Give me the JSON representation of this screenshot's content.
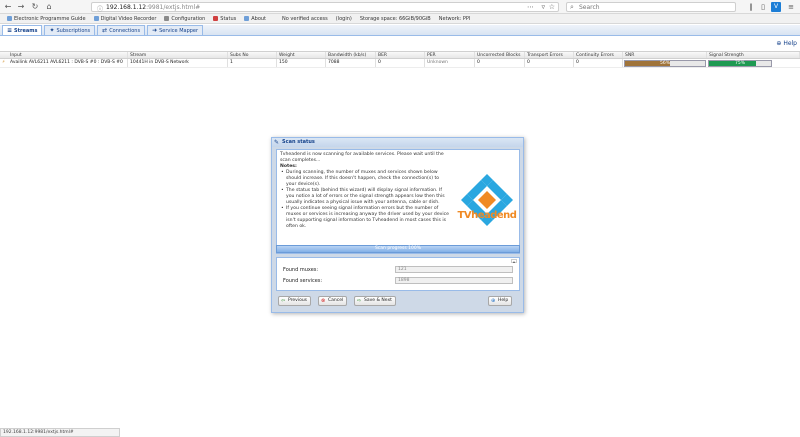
{
  "browser": {
    "url_host": "192.168.1.12",
    "url_rest": ":9981/extjs.html#",
    "search_placeholder": "Search",
    "nav": {
      "back": "←",
      "forward": "→",
      "reload": "↻",
      "home": "⌂"
    },
    "toolbar_icons": [
      "library-icon",
      "sidebar-icon",
      "extension-icon",
      "menu-icon"
    ]
  },
  "bookmarks": [
    {
      "label": "Electronic Programme Guide",
      "color": "#6f9fd8"
    },
    {
      "label": "Digital Video Recorder",
      "color": "#6f9fd8"
    },
    {
      "label": "Configuration",
      "color": "#8a8a8a"
    },
    {
      "label": "Status",
      "color": "#d04040"
    },
    {
      "label": "About",
      "color": "#6f9fd8"
    },
    {
      "label": "No verified access",
      "color": ""
    },
    {
      "label": "(login)",
      "color": ""
    },
    {
      "label": "Storage space: 66GiB/90GiB",
      "color": ""
    },
    {
      "label": "Network: PPI",
      "color": ""
    }
  ],
  "subtabs": [
    {
      "label": "Streams",
      "icon": "≡",
      "active": true
    },
    {
      "label": "Subscriptions",
      "icon": "✦",
      "active": false
    },
    {
      "label": "Connections",
      "icon": "⇄",
      "active": false
    },
    {
      "label": "Service Mapper",
      "icon": "➜",
      "active": false
    }
  ],
  "help": "Help",
  "grid": {
    "headers": [
      "Input",
      "Stream",
      "Subs No",
      "Weight",
      "Bandwidth (kb/s)",
      "BER",
      "PER",
      "Uncorrected Blocks",
      "Transport Errors",
      "Continuity Errors",
      "SNR",
      "Signal Strength"
    ],
    "row": {
      "input": "Availink AVL6211 AVL6211 : DVB-S #0 : DVB-S #0",
      "stream": "10441H in DVB-S Network",
      "subs": "1",
      "weight": "150",
      "bandwidth": "7088",
      "ber": "0",
      "per": "Unknown",
      "unc": "0",
      "te": "0",
      "cc": "0",
      "snr": "56%",
      "snr_value": 0.56,
      "signal": "75%",
      "signal_value": 0.75
    }
  },
  "dialog": {
    "title": "Scan status",
    "intro": "Tvheadend is now scanning for available services. Please wait until the scan completes...",
    "notes_label": "Notes:",
    "notes": [
      "During scanning, the number of muxes and services shown below should increase. If this doesn't happen, check the connection(s) to your device(s).",
      "The status tab (behind this wizard) will display signal information. If you notice a lot of errors or the signal strength appears low then this usually indicates a physical issue with your antenna, cable or dish.",
      "If you continue seeing signal information errors but the number of muxes or services is increasing anyway the driver used by your device isn't supporting signal information to Tvheadend in most cases this is often ok."
    ],
    "logo_text": "TVheadend",
    "progress_label": "Scan progress 100%",
    "progress_value": 1.0,
    "stats": [
      {
        "label": "Found muxes:",
        "value": "121"
      },
      {
        "label": "Found services:",
        "value": "1898"
      }
    ],
    "buttons": {
      "previous": "Previous",
      "cancel": "Cancel",
      "save_next": "Save & Next",
      "help": "Help"
    }
  },
  "status_bar": "192.168.1.12:9981/extjs.html#"
}
